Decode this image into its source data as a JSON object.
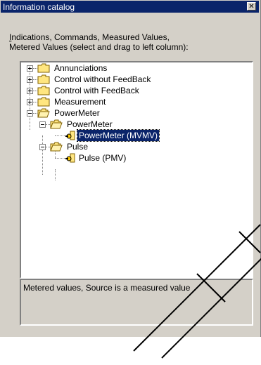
{
  "window": {
    "title": "Information catalog",
    "close_glyph": "✕"
  },
  "instructions": {
    "line1_underlined": "I",
    "line1_rest": "ndications, Commands, Measured Values,",
    "line2": "Metered Values (select and drag to left column):"
  },
  "tree": {
    "items": [
      {
        "label": "Annunciations",
        "expanded": false
      },
      {
        "label": "Control without FeedBack",
        "expanded": false
      },
      {
        "label": "Control with FeedBack",
        "expanded": false
      },
      {
        "label": "Measurement",
        "expanded": false
      },
      {
        "label": "PowerMeter",
        "expanded": true
      },
      {
        "label": "PowerMeter",
        "expanded": true
      },
      {
        "label": "PowerMeter (MVMV)",
        "selected": true
      },
      {
        "label": "Pulse",
        "expanded": true
      },
      {
        "label": "Pulse (PMV)",
        "selected": false
      }
    ]
  },
  "description": {
    "text": "Metered values, Source is a measured value"
  },
  "colors": {
    "title_bar": "#0a246a",
    "panel": "#d4d0c8",
    "folder": "#ffe680",
    "selection": "#0a246a"
  }
}
